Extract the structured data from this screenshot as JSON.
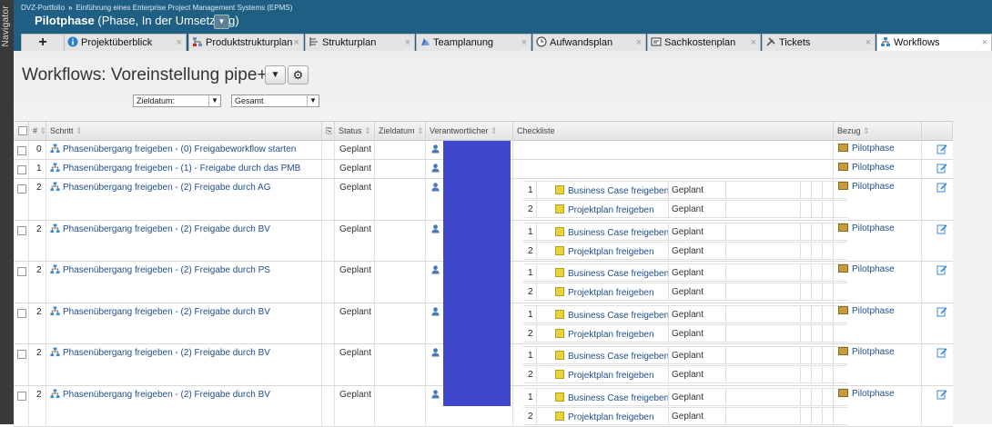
{
  "navigator": {
    "label": "Navigator"
  },
  "breadcrumb": {
    "root": "DVZ-Portfolio",
    "separator": "»",
    "program": "Einführung eines Enterprise Project Management Systems (EPMS)"
  },
  "project": {
    "name": "Pilotphase",
    "status": "(Phase, In der Umsetzung)"
  },
  "tabs": [
    {
      "label": "Projektüberblick",
      "icon": "info-icon"
    },
    {
      "label": "Produktstrukturplan",
      "icon": "structure-icon"
    },
    {
      "label": "Strukturplan",
      "icon": "tree-icon"
    },
    {
      "label": "Teamplanung",
      "icon": "team-icon"
    },
    {
      "label": "Aufwandsplan",
      "icon": "clock-icon"
    },
    {
      "label": "Sachkostenplan",
      "icon": "cost-icon"
    },
    {
      "label": "Tickets",
      "icon": "tools-icon"
    },
    {
      "label": "Workflows",
      "icon": "workflow-icon",
      "active": true
    }
  ],
  "page": {
    "title": "Workflows: Voreinstellung pipe+"
  },
  "filters": {
    "date": "Zieldatum:",
    "scope": "Gesamt"
  },
  "columns": {
    "num": "#",
    "step": "Schritt",
    "status": "Status",
    "due": "Zieldatum",
    "owner": "Verantwortlicher",
    "checklist": "Checkliste",
    "ref": "Bezug"
  },
  "rows": [
    {
      "num": "0",
      "step": "Phasenübergang freigeben - (0) Freigabeworkflow starten",
      "status": "Geplant",
      "ref": "Pilotphase",
      "checklist": []
    },
    {
      "num": "1",
      "step": "Phasenübergang freigeben - (1) - Freigabe durch das PMB",
      "status": "Geplant",
      "ref": "Pilotphase",
      "checklist": []
    },
    {
      "num": "2",
      "step": "Phasenübergang freigeben - (2) Freigabe durch AG",
      "status": "Geplant",
      "ref": "Pilotphase",
      "checklist": [
        {
          "n": "1",
          "label": "Business Case freigeben",
          "status": "Geplant"
        },
        {
          "n": "2",
          "label": "Projektplan freigeben",
          "status": "Geplant"
        }
      ]
    },
    {
      "num": "2",
      "step": "Phasenübergang freigeben - (2) Freigabe durch BV",
      "status": "Geplant",
      "ref": "Pilotphase",
      "checklist": [
        {
          "n": "1",
          "label": "Business Case freigeben",
          "status": "Geplant"
        },
        {
          "n": "2",
          "label": "Projektplan freigeben",
          "status": "Geplant"
        }
      ]
    },
    {
      "num": "2",
      "step": "Phasenübergang freigeben - (2) Freigabe durch PS",
      "status": "Geplant",
      "ref": "Pilotphase",
      "checklist": [
        {
          "n": "1",
          "label": "Business Case freigeben",
          "status": "Geplant"
        },
        {
          "n": "2",
          "label": "Projektplan freigeben",
          "status": "Geplant"
        }
      ]
    },
    {
      "num": "2",
      "step": "Phasenübergang freigeben - (2) Freigabe durch BV",
      "status": "Geplant",
      "ref": "Pilotphase",
      "checklist": [
        {
          "n": "1",
          "label": "Business Case freigeben",
          "status": "Geplant"
        },
        {
          "n": "2",
          "label": "Projektplan freigeben",
          "status": "Geplant"
        }
      ]
    },
    {
      "num": "2",
      "step": "Phasenübergang freigeben - (2) Freigabe durch BV",
      "status": "Geplant",
      "ref": "Pilotphase",
      "checklist": [
        {
          "n": "1",
          "label": "Business Case freigeben",
          "status": "Geplant"
        },
        {
          "n": "2",
          "label": "Projektplan freigeben",
          "status": "Geplant"
        }
      ]
    },
    {
      "num": "2",
      "step": "Phasenübergang freigeben - (2) Freigabe durch BV",
      "status": "Geplant",
      "ref": "Pilotphase",
      "checklist": [
        {
          "n": "1",
          "label": "Business Case freigeben",
          "status": "Geplant"
        },
        {
          "n": "2",
          "label": "Projektplan freigeben",
          "status": "Geplant"
        }
      ]
    }
  ]
}
